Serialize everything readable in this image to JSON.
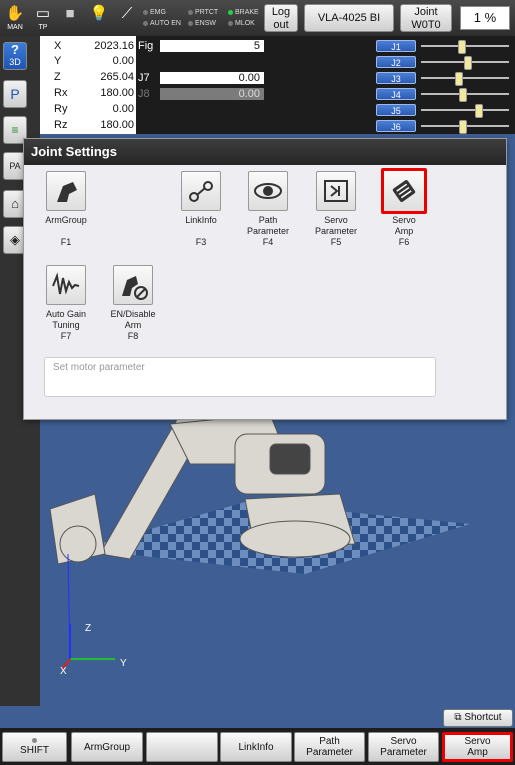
{
  "statusbar": {
    "icons": [
      {
        "name": "hand-icon",
        "label": "MAN"
      },
      {
        "name": "pendant-icon",
        "label": "TP"
      },
      {
        "name": "stop-icon",
        "label": ""
      },
      {
        "name": "lamp-icon",
        "label": ""
      },
      {
        "name": "wrench-icon",
        "label": ""
      }
    ],
    "indicators": {
      "emg": "EMG",
      "auto_en": "AUTO EN",
      "prtct": "PRTCT",
      "ensw": "ENSW",
      "brake": "BRAKE",
      "mlok": "MLOK"
    },
    "logout_label": "Log out",
    "robot_model": "VLA-4025 BI",
    "joint_title": "Joint",
    "joint_value": "W0T0",
    "speed": "1 %"
  },
  "sidebar": {
    "btn_3d": "3D",
    "btn_pa": "PA"
  },
  "coords": [
    {
      "label": "X",
      "value": "2023.16"
    },
    {
      "label": "Y",
      "value": "0.00"
    },
    {
      "label": "Z",
      "value": "265.04"
    },
    {
      "label": "Rx",
      "value": "180.00"
    },
    {
      "label": "Ry",
      "value": "0.00"
    },
    {
      "label": "Rz",
      "value": "180.00"
    }
  ],
  "fig": {
    "label": "Fig",
    "value": "5"
  },
  "j7": {
    "label": "J7",
    "value": "0.00"
  },
  "j8": {
    "label": "J8",
    "value": "0.00"
  },
  "joints": [
    {
      "label": "J1",
      "level": 0.45
    },
    {
      "label": "J2",
      "level": 0.52
    },
    {
      "label": "J3",
      "level": 0.42
    },
    {
      "label": "J4",
      "level": 0.46
    },
    {
      "label": "J5",
      "level": 0.66
    },
    {
      "label": "J6",
      "level": 0.46
    }
  ],
  "dialog": {
    "title": "Joint Settings",
    "items": [
      {
        "name": "arm-group",
        "line1": "ArmGroup",
        "line2": "",
        "key": "F1",
        "icon": "arm-group-icon"
      },
      {
        "name": "link-info",
        "line1": "LinkInfo",
        "line2": "",
        "key": "F3",
        "icon": "link-info-icon"
      },
      {
        "name": "path-parameter",
        "line1": "Path",
        "line2": "Parameter",
        "key": "F4",
        "icon": "path-parameter-icon"
      },
      {
        "name": "servo-parameter",
        "line1": "Servo",
        "line2": "Parameter",
        "key": "F5",
        "icon": "servo-parameter-icon"
      },
      {
        "name": "servo-amp",
        "line1": "Servo",
        "line2": "Amp",
        "key": "F6",
        "icon": "servo-amp-icon"
      },
      {
        "name": "auto-gain-tuning",
        "line1": "Auto Gain",
        "line2": "Tuning",
        "key": "F7",
        "icon": "waveform-icon"
      },
      {
        "name": "en-disable-arm",
        "line1": "EN/Disable",
        "line2": "Arm",
        "key": "F8",
        "icon": "disable-arm-icon"
      }
    ],
    "message": "Set motor parameter"
  },
  "axes": {
    "x": "X",
    "y": "Y",
    "z": "Z"
  },
  "shortcut_label": "Shortcut",
  "fkeys": [
    {
      "line1": "SHIFT",
      "line2": ""
    },
    {
      "line1": "ArmGroup",
      "line2": ""
    },
    {
      "line1": "",
      "line2": ""
    },
    {
      "line1": "LinkInfo",
      "line2": ""
    },
    {
      "line1": "Path",
      "line2": "Parameter"
    },
    {
      "line1": "Servo",
      "line2": "Parameter"
    },
    {
      "line1": "Servo",
      "line2": "Amp"
    }
  ]
}
